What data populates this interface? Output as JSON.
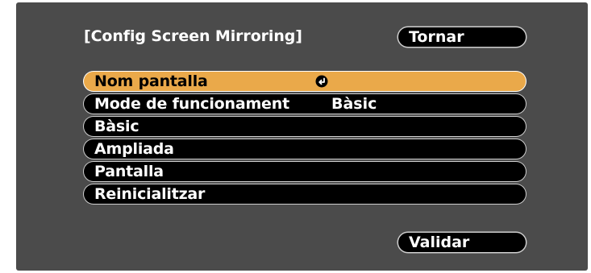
{
  "dialog": {
    "title": "[Config Screen Mirroring]",
    "back_label": "Tornar",
    "validate_label": "Validar"
  },
  "menu": {
    "items": [
      {
        "label": "Nom pantalla",
        "value": "",
        "selected": true,
        "icon": "enter-icon"
      },
      {
        "label": "Mode de funcionament",
        "value": "Bàsic"
      },
      {
        "label": "Bàsic",
        "value": ""
      },
      {
        "label": "Ampliada",
        "value": ""
      },
      {
        "label": "Pantalla",
        "value": ""
      },
      {
        "label": "Reinicialitzar",
        "value": ""
      }
    ]
  },
  "colors": {
    "panel_background": "#4b4b4b",
    "highlight": "#eaa94a",
    "item_background": "#000000"
  }
}
